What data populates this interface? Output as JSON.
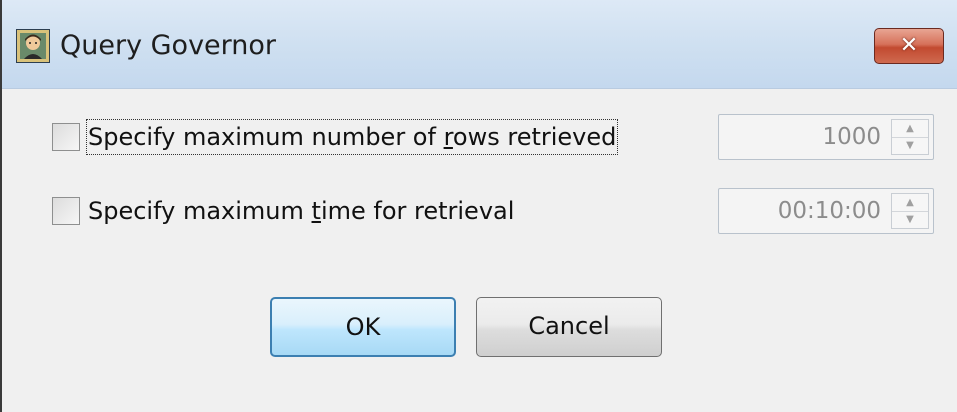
{
  "window": {
    "title": "Query Governor",
    "close_label": "✕",
    "app_icon": "person-icon"
  },
  "options": {
    "max_rows": {
      "label_pre": "Specify maximum number of ",
      "label_accel": "r",
      "label_post": "ows retrieved",
      "checked": false,
      "value": "1000"
    },
    "max_time": {
      "label_pre": "Specify maximum ",
      "label_accel": "t",
      "label_post": "ime for retrieval",
      "checked": false,
      "value": "00:10:00"
    }
  },
  "buttons": {
    "ok_label": "OK",
    "cancel_label": "Cancel"
  },
  "spin_icons": {
    "up": "▲",
    "down": "▼"
  }
}
